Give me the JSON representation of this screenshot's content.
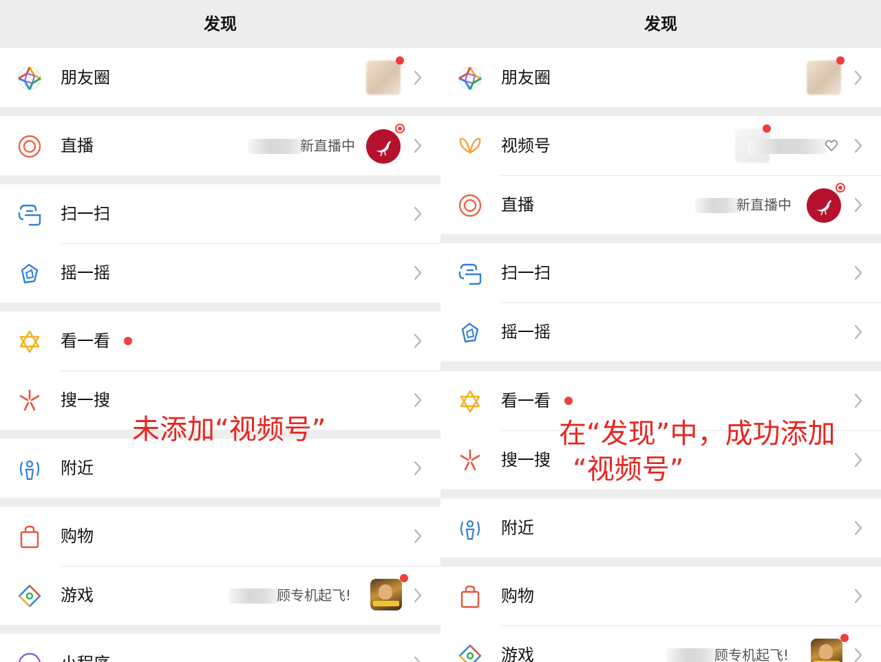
{
  "left": {
    "title": "发现",
    "rows": {
      "moments": "朋友圈",
      "live": "直播",
      "live_status": "新直播中",
      "scan": "扫一扫",
      "shake": "摇一摇",
      "look": "看一看",
      "search": "搜一搜",
      "nearby": "附近",
      "shopping": "购物",
      "games": "游戏",
      "games_status": "顾专机起飞!",
      "mini": "小程序"
    },
    "annotation": "未添加“视频号”"
  },
  "right": {
    "title": "发现",
    "rows": {
      "moments": "朋友圈",
      "channels": "视频号",
      "live": "直播",
      "live_status": "新直播中",
      "scan": "扫一扫",
      "shake": "摇一摇",
      "look": "看一看",
      "search": "搜一搜",
      "nearby": "附近",
      "shopping": "购物",
      "games": "游戏",
      "games_status": "顾专机起飞!"
    },
    "annotation_line1": "在“发现”中，成功添加",
    "annotation_line2": "“视频号”"
  },
  "colors": {
    "annotation": "#e8261f",
    "badge": "#ee3e3e",
    "live_avatar": "#b5122e"
  },
  "icons": {
    "moments": "aperture-icon",
    "channels": "butterfly-icon",
    "live": "live-target-icon",
    "scan": "scan-icon",
    "shake": "shake-icon",
    "look": "star-of-david-icon",
    "search": "search-spark-icon",
    "nearby": "nearby-person-icon",
    "shopping": "shopping-bag-icon",
    "games": "game-diamond-icon",
    "mini": "mini-program-icon"
  }
}
